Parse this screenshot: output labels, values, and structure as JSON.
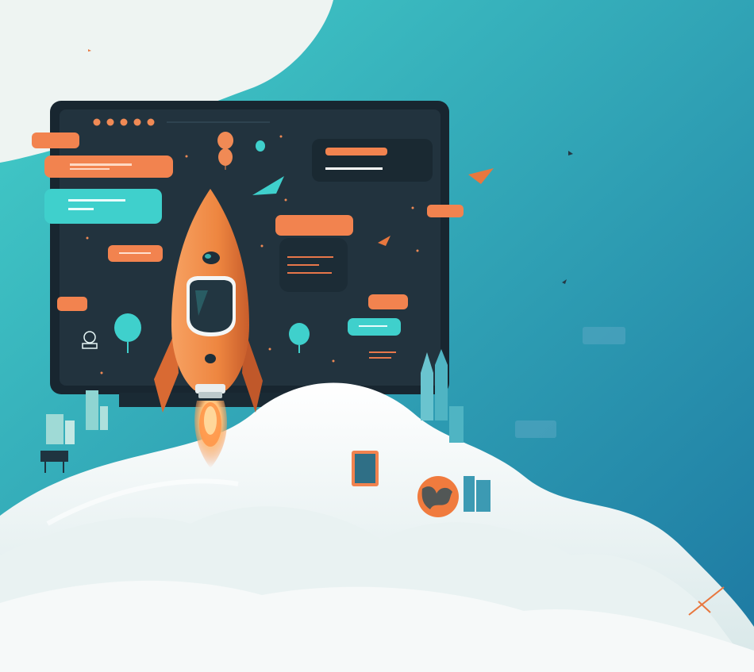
{
  "scene": {
    "subject": "rocket-launch-illustration",
    "palette": {
      "sky_light": "#3fc9c6",
      "sky_dark": "#1f7fa6",
      "cloud_white": "#f1f5f4",
      "cloud_shadow": "#cfe3e4",
      "monitor_bezel": "#1b2a33",
      "monitor_screen": "#22323d",
      "accent_orange": "#f2824d",
      "accent_teal": "#3fd0cc",
      "rocket_orange": "#f08a3f",
      "rocket_dark": "#c2582a",
      "flame_yellow": "#ffd38a"
    },
    "icons": [
      "rocket-icon",
      "hot-air-balloon-icon",
      "paper-plane-icon",
      "bird-icon",
      "globe-icon",
      "city-skyline-icon",
      "lightbulb-icon",
      "monitor-icon"
    ]
  }
}
